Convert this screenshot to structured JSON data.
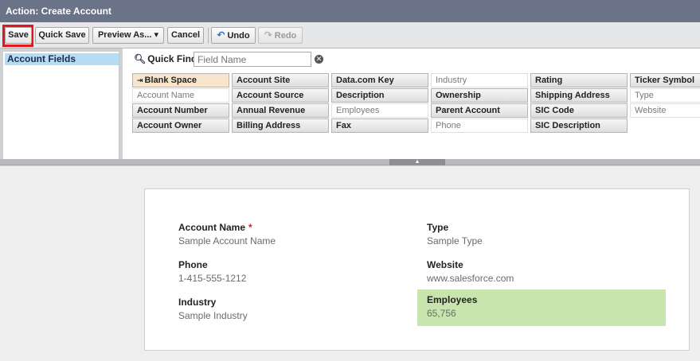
{
  "title": "Action: Create Account",
  "toolbar": {
    "save": "Save",
    "quick_save": "Quick Save",
    "preview_as": "Preview As...",
    "cancel": "Cancel",
    "undo": "Undo",
    "redo": "Redo"
  },
  "palette": {
    "category": "Account Fields",
    "quick_find_label": "Quick Find",
    "quick_find_placeholder": "Field Name",
    "fields": [
      [
        "Blank Space",
        "Account Site",
        "Data.com Key",
        "Industry",
        "Rating",
        "Ticker Symbol"
      ],
      [
        "Account Name",
        "Account Source",
        "Description",
        "Ownership",
        "Shipping Address",
        "Type"
      ],
      [
        "Account Number",
        "Annual Revenue",
        "Employees",
        "Parent Account",
        "SIC Code",
        "Website"
      ],
      [
        "Account Owner",
        "Billing Address",
        "Fax",
        "Phone",
        "SIC Description",
        ""
      ]
    ]
  },
  "layout": {
    "left": [
      {
        "label": "Account Name",
        "value": "Sample Account Name",
        "required": "*"
      },
      {
        "label": "Phone",
        "value": "1-415-555-1212"
      },
      {
        "label": "Industry",
        "value": "Sample Industry"
      }
    ],
    "right": [
      {
        "label": "Type",
        "value": "Sample Type"
      },
      {
        "label": "Website",
        "value": "www.salesforce.com"
      },
      {
        "label": "Employees",
        "value": "65,756"
      }
    ]
  }
}
